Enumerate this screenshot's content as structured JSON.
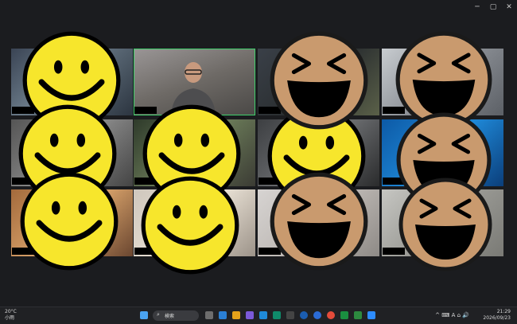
{
  "window": {
    "minimize": "─",
    "maximize": "▢",
    "close": "✕"
  },
  "tiles": [
    {
      "id": "t0"
    },
    {
      "id": "t1",
      "active": true
    },
    {
      "id": "t2"
    },
    {
      "id": "t3"
    },
    {
      "id": "t4"
    },
    {
      "id": "t5"
    },
    {
      "id": "t6"
    },
    {
      "id": "t7"
    },
    {
      "id": "t8"
    },
    {
      "id": "t9"
    },
    {
      "id": "t10"
    },
    {
      "id": "t11"
    }
  ],
  "emojis": {
    "yellow": "smiling-face-emoji",
    "brown": "laughing-face-emoji"
  },
  "taskbar": {
    "weather_temp": "20°C",
    "weather_desc": "小雨",
    "search_placeholder": "検索",
    "tray_icons": [
      "^",
      "⌨",
      "A",
      "⌂",
      "🔊"
    ],
    "time": "21:29",
    "date": "2026/09/23"
  },
  "colors": {
    "yellow_face": "#f7e62c",
    "brown_face": "#c99a6e",
    "active_tile_border": "#3fd06b"
  }
}
